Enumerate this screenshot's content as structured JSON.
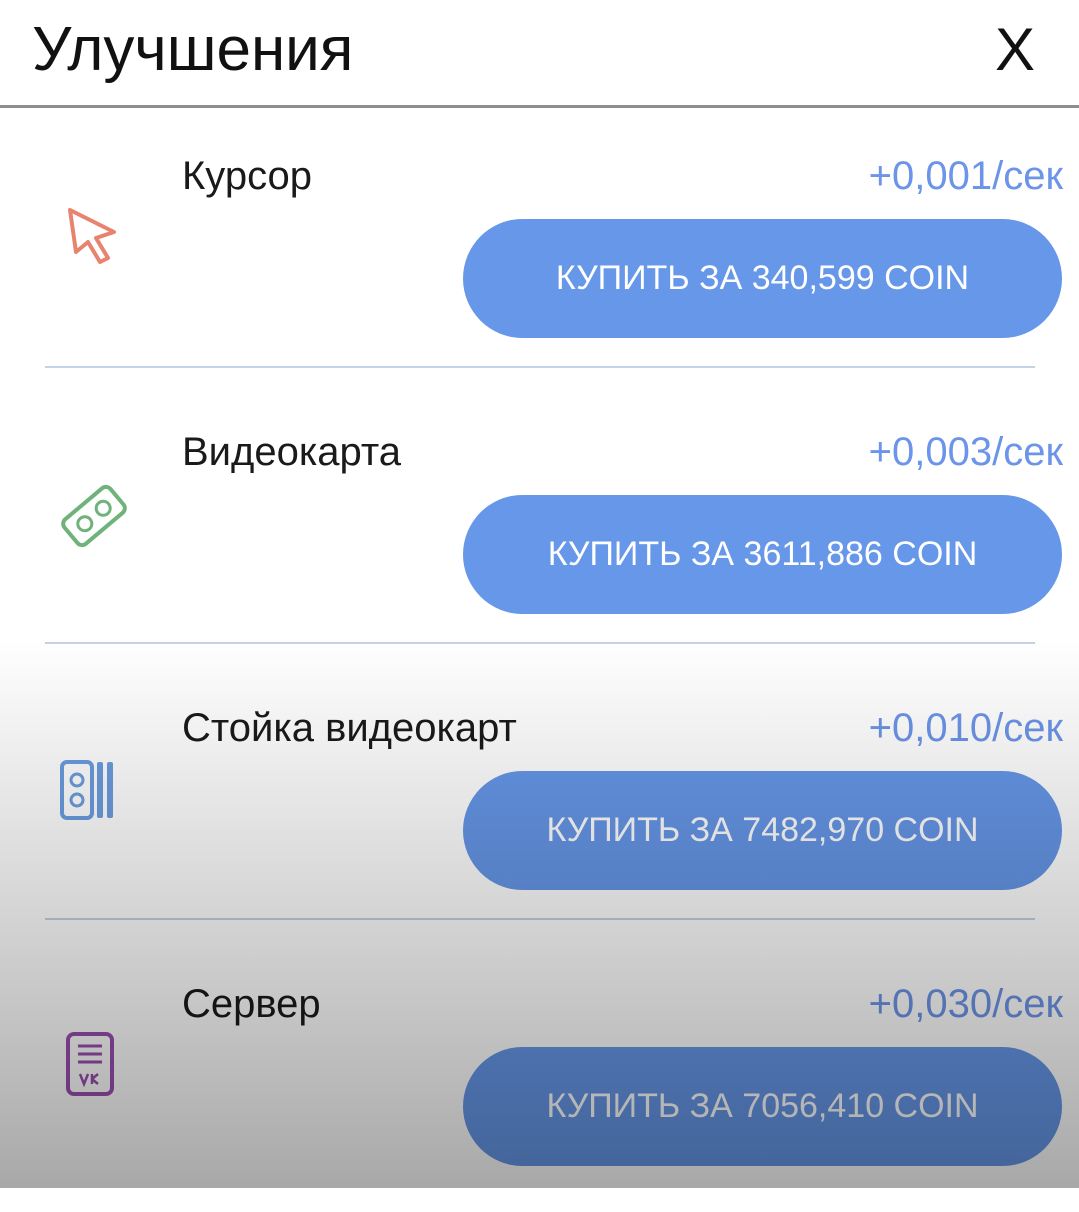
{
  "header": {
    "title": "Улучшения",
    "close_label": "X"
  },
  "upgrades": [
    {
      "name": "Курсор",
      "rate": "+0,001/сек",
      "buy_label": "КУПИТЬ ЗА 340,599 COIN",
      "icon": "cursor-icon",
      "icon_color": "#e8836e"
    },
    {
      "name": "Видеокарта",
      "rate": "+0,003/сек",
      "buy_label": "КУПИТЬ ЗА 3611,886 COIN",
      "icon": "videocard-icon",
      "icon_color": "#6fb27a"
    },
    {
      "name": "Стойка видеокарт",
      "rate": "+0,010/сек",
      "buy_label": "КУПИТЬ ЗА 7482,970 COIN",
      "icon": "videocard-rack-icon",
      "icon_color": "#6c9de0"
    },
    {
      "name": "Сервер",
      "rate": "+0,030/сек",
      "buy_label": "КУПИТЬ ЗА 7056,410 COIN",
      "icon": "server-icon",
      "icon_color": "#9a4fb0"
    }
  ],
  "colors": {
    "accent": "#6697e8",
    "rate_text": "#6c94e8",
    "divider": "#c4d2e6"
  }
}
